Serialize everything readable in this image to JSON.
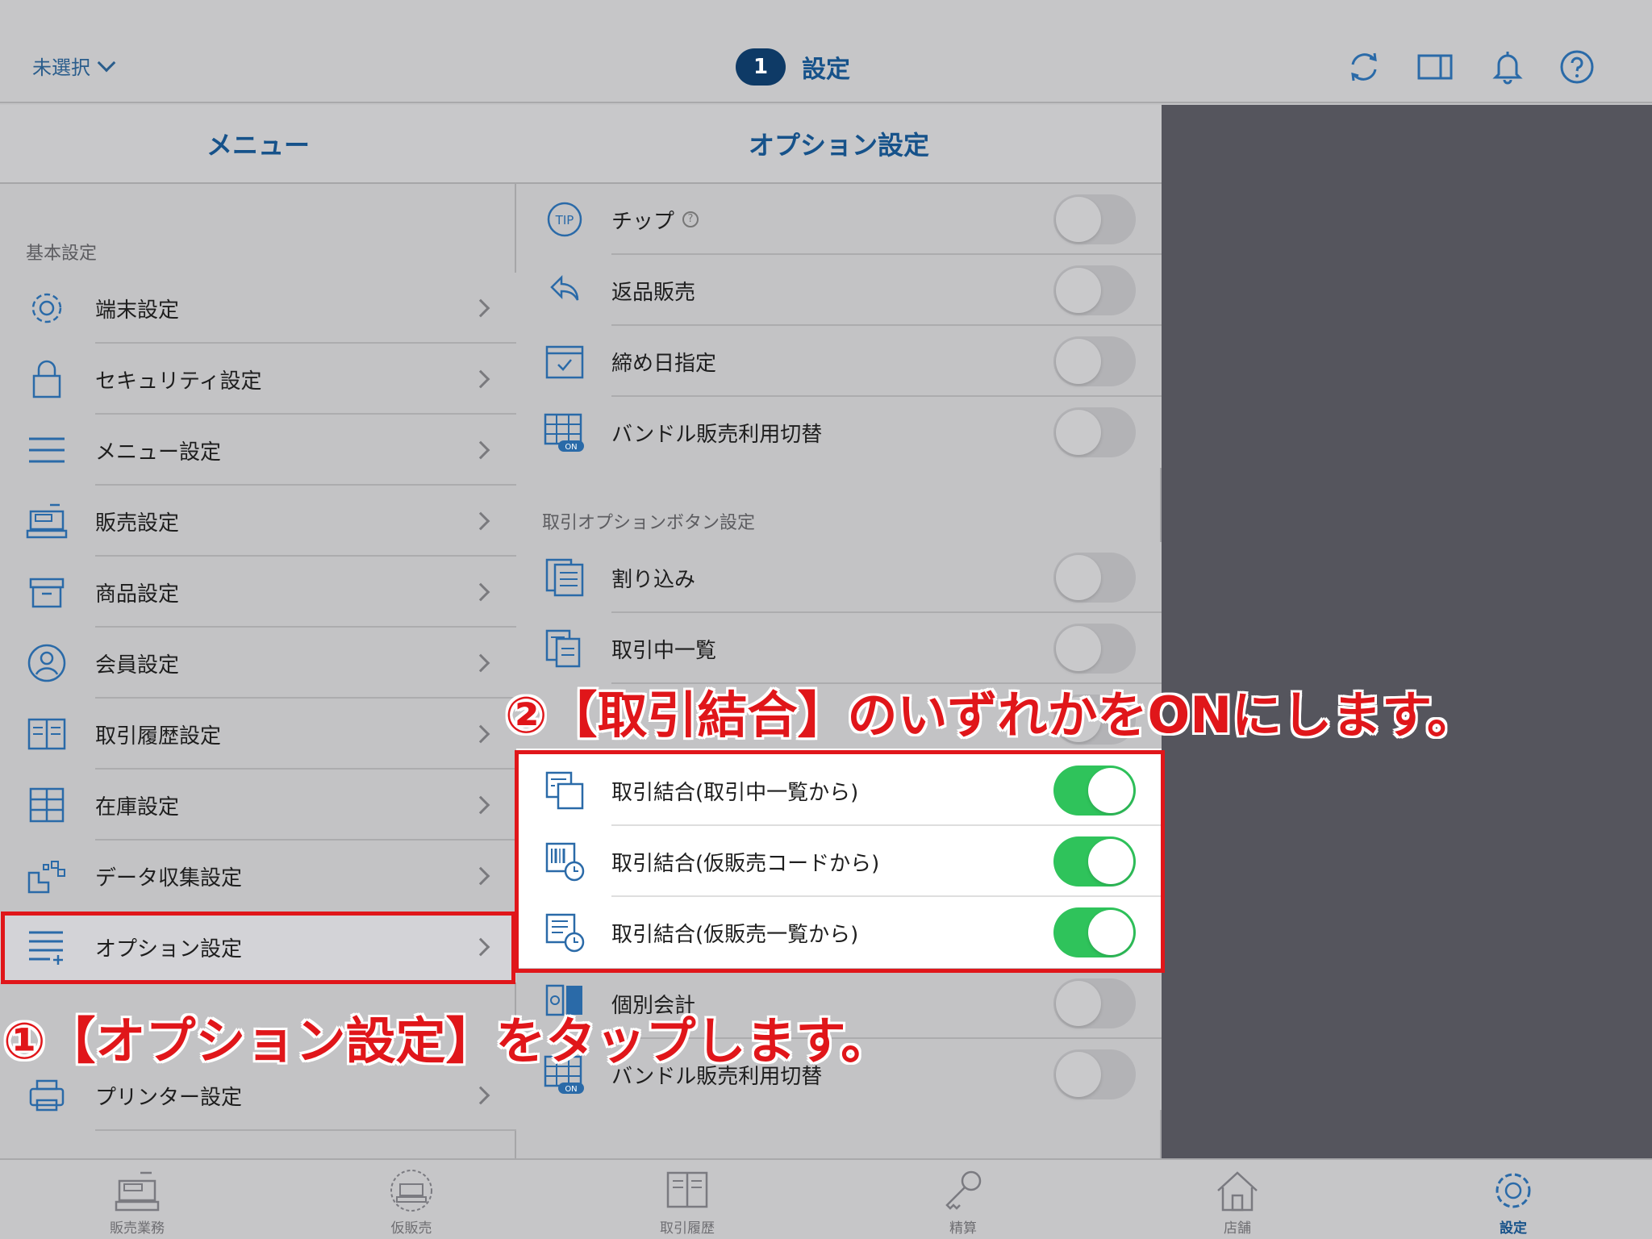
{
  "header": {
    "shop_select": "未選択",
    "badge": "1",
    "title": "設定",
    "icons": [
      "sync-icon",
      "split-view-icon",
      "bell-icon",
      "help-icon"
    ]
  },
  "menu": {
    "title": "メニュー",
    "section": "基本設定",
    "items": [
      {
        "label": "端末設定",
        "icon": "gear-icon"
      },
      {
        "label": "セキュリティ設定",
        "icon": "lock-icon"
      },
      {
        "label": "メニュー設定",
        "icon": "menu-lines-icon"
      },
      {
        "label": "販売設定",
        "icon": "register-icon"
      },
      {
        "label": "商品設定",
        "icon": "box-icon"
      },
      {
        "label": "会員設定",
        "icon": "person-icon"
      },
      {
        "label": "取引履歴設定",
        "icon": "book-icon"
      },
      {
        "label": "在庫設定",
        "icon": "cabinet-icon"
      },
      {
        "label": "データ収集設定",
        "icon": "data-icon"
      },
      {
        "label": "オプション設定",
        "icon": "list-plus-icon"
      },
      {
        "label": "プリンター設定",
        "icon": "printer-icon"
      }
    ]
  },
  "options": {
    "title": "オプション設定",
    "section": "取引オプションボタン設定",
    "rows": [
      {
        "label": "チップ",
        "on": false,
        "icon": "tip-icon"
      },
      {
        "label": "返品販売",
        "on": false,
        "icon": "return-icon"
      },
      {
        "label": "締め日指定",
        "on": false,
        "icon": "calendar-icon"
      },
      {
        "label": "バンドル販売利用切替",
        "on": false,
        "icon": "bundle-on-icon"
      },
      {
        "label": "割り込み",
        "on": false,
        "icon": "documents-icon"
      },
      {
        "label": "取引中一覧",
        "on": false,
        "icon": "documents-arrows-icon"
      },
      {
        "label": "取引結合(取引中一覧から)",
        "on": true,
        "icon": "merge-doc-icon"
      },
      {
        "label": "取引結合(仮販売コードから)",
        "on": true,
        "icon": "barcode-clock-icon"
      },
      {
        "label": "取引結合(仮販売一覧から)",
        "on": true,
        "icon": "list-clock-icon"
      },
      {
        "label": "個別会計",
        "on": false,
        "icon": "split-bill-icon"
      },
      {
        "label": "バンドル販売利用切替",
        "on": false,
        "icon": "bundle-on-icon"
      }
    ]
  },
  "annotations": {
    "step1": "①【オプション設定】をタップします。",
    "step2": "②【取引結合】のいずれかをONにします。",
    "color": "#e0161a"
  },
  "tabs": [
    {
      "label": "販売業務",
      "icon": "register-icon"
    },
    {
      "label": "仮販売",
      "icon": "pending-sale-icon"
    },
    {
      "label": "取引履歴",
      "icon": "book-icon"
    },
    {
      "label": "精算",
      "icon": "key-icon"
    },
    {
      "label": "店舗",
      "icon": "house-icon"
    },
    {
      "label": "設定",
      "icon": "gear-icon",
      "active": true
    }
  ],
  "colors": {
    "accent": "#16528a",
    "toggle_on": "#2fc35b",
    "annotation": "#e0161a"
  }
}
